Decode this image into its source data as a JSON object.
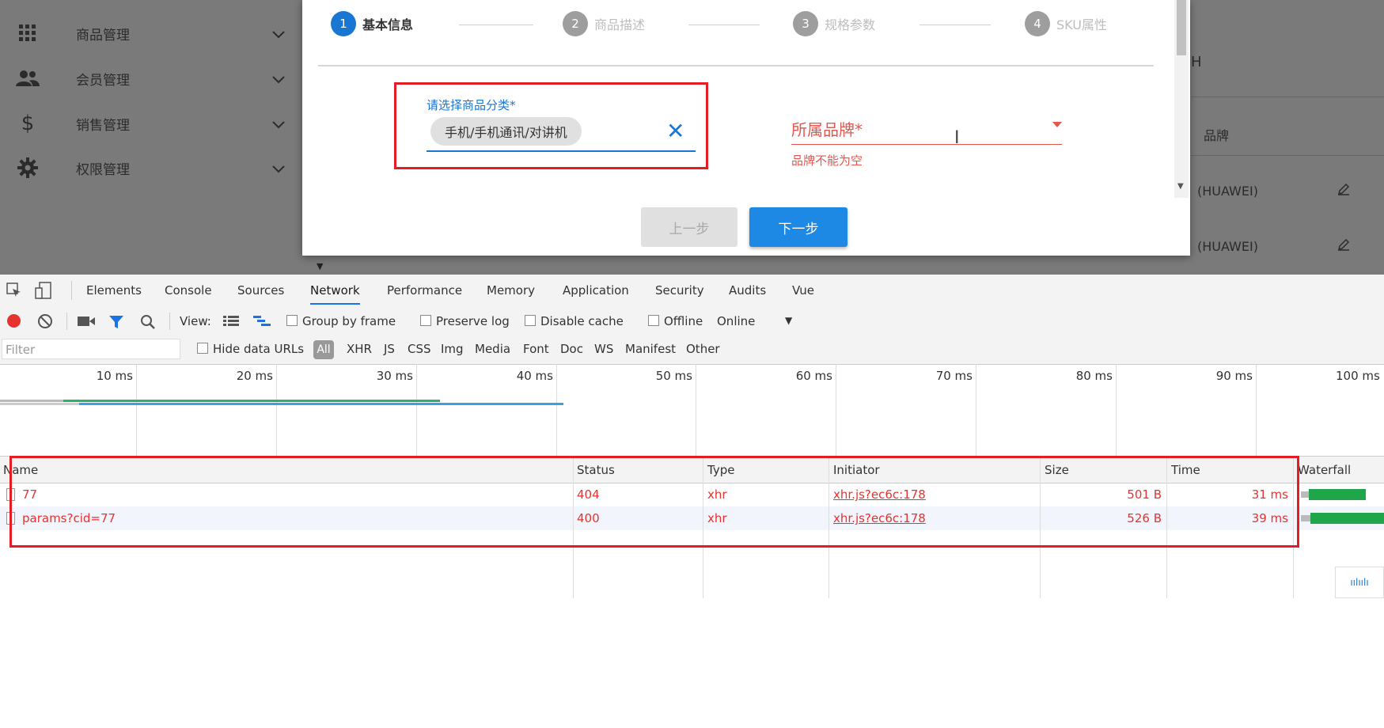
{
  "sidebar": {
    "items": [
      {
        "label": "商品管理",
        "icon": "grid-icon"
      },
      {
        "label": "会员管理",
        "icon": "people-icon"
      },
      {
        "label": "销售管理",
        "icon": "dollar-icon"
      },
      {
        "label": "权限管理",
        "icon": "gear-icon"
      }
    ]
  },
  "right_panel": {
    "col_header": "品牌",
    "rows": [
      "(HUAWEI)",
      "(HUAWEI)"
    ],
    "header_fragment": "H"
  },
  "dialog": {
    "steps": [
      {
        "num": "1",
        "label": "基本信息"
      },
      {
        "num": "2",
        "label": "商品描述"
      },
      {
        "num": "3",
        "label": "规格参数"
      },
      {
        "num": "4",
        "label": "SKU属性"
      }
    ],
    "category_label": "请选择商品分类*",
    "category_chip": "手机/手机通讯/对讲机",
    "clear_symbol": "✕",
    "brand_label": "所属品牌*",
    "brand_error": "品牌不能为空",
    "prev_button": "上一步",
    "next_button": "下一步"
  },
  "devtools": {
    "tabs": [
      "Elements",
      "Console",
      "Sources",
      "Network",
      "Performance",
      "Memory",
      "Application",
      "Security",
      "Audits",
      "Vue"
    ],
    "active_tab": "Network",
    "toolbar": {
      "view_label": "View:",
      "group_by_frame": "Group by frame",
      "preserve_log": "Preserve log",
      "disable_cache": "Disable cache",
      "offline": "Offline",
      "throttle": "Online"
    },
    "filter_bar": {
      "placeholder": "Filter",
      "hide_data_urls": "Hide data URLs",
      "types": [
        "All",
        "XHR",
        "JS",
        "CSS",
        "Img",
        "Media",
        "Font",
        "Doc",
        "WS",
        "Manifest",
        "Other"
      ]
    },
    "timeline_ticks": [
      "10 ms",
      "20 ms",
      "30 ms",
      "40 ms",
      "50 ms",
      "60 ms",
      "70 ms",
      "80 ms",
      "90 ms",
      "100 ms"
    ],
    "columns": [
      "Name",
      "Status",
      "Type",
      "Initiator",
      "Size",
      "Time",
      "Waterfall"
    ],
    "requests": [
      {
        "name": "77",
        "status": "404",
        "type": "xhr",
        "initiator": "xhr.js?ec6c:178",
        "size": "501 B",
        "time": "31 ms"
      },
      {
        "name": "params?cid=77",
        "status": "400",
        "type": "xhr",
        "initiator": "xhr.js?ec6c:178",
        "size": "526 B",
        "time": "39 ms"
      }
    ]
  },
  "corner_logo": "ıılıılı"
}
